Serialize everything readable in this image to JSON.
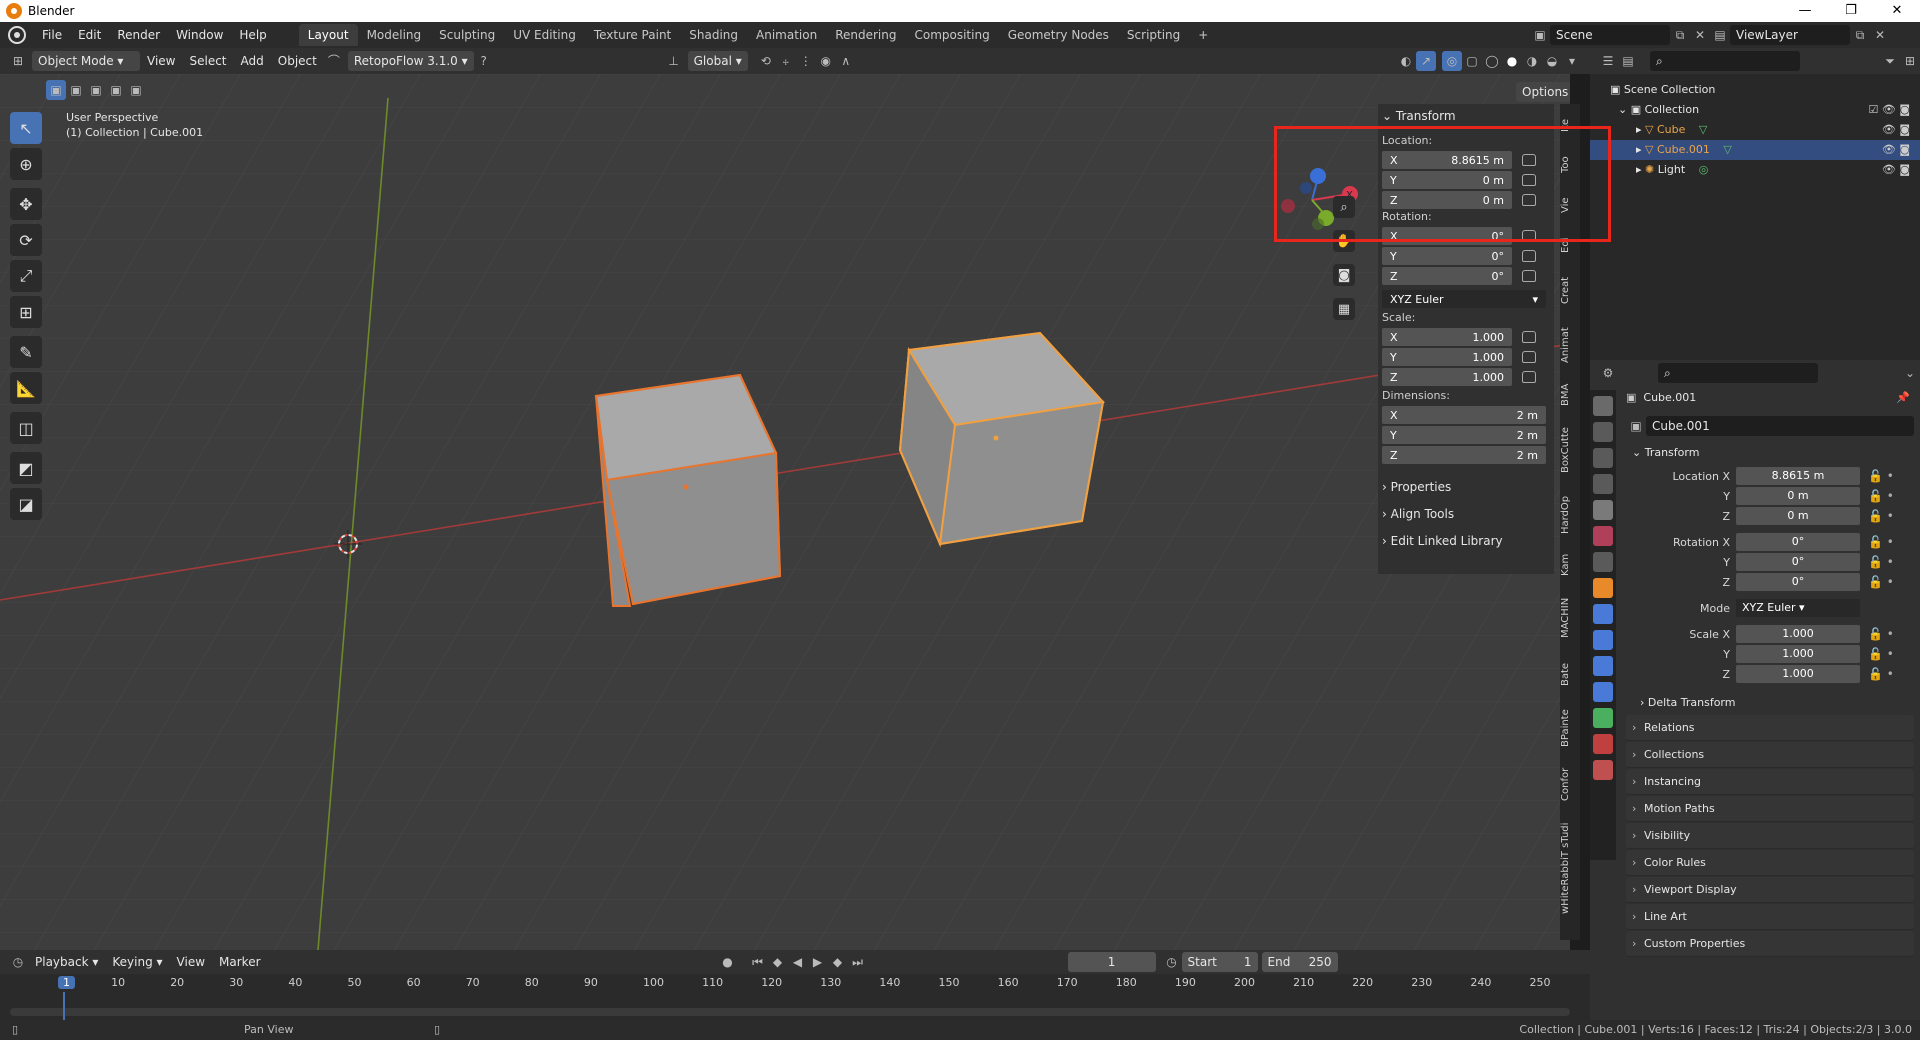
{
  "window": {
    "title": "Blender",
    "buttons": [
      "—",
      "❐",
      "✕"
    ]
  },
  "menu": [
    "File",
    "Edit",
    "Render",
    "Window",
    "Help"
  ],
  "workspaces": [
    "Layout",
    "Modeling",
    "Sculpting",
    "UV Editing",
    "Texture Paint",
    "Shading",
    "Animation",
    "Rendering",
    "Compositing",
    "Geometry Nodes",
    "Scripting"
  ],
  "active_workspace": "Layout",
  "scene": {
    "label": "Scene",
    "view_layer": "ViewLayer"
  },
  "viewport_header": {
    "mode": "Object Mode",
    "menus": [
      "View",
      "Select",
      "Add",
      "Object"
    ],
    "addon": "RetopoFlow 3.1.0",
    "orientation": "Global",
    "options": "Options"
  },
  "viewport_overlay": {
    "perspective": "User Perspective",
    "context": "(1) Collection | Cube.001"
  },
  "npanel": {
    "title": "Transform",
    "location_label": "Location:",
    "location": [
      {
        "axis": "X",
        "value": "8.8615 m"
      },
      {
        "axis": "Y",
        "value": "0 m"
      },
      {
        "axis": "Z",
        "value": "0 m"
      }
    ],
    "rotation_label": "Rotation:",
    "rotation": [
      {
        "axis": "X",
        "value": "0°"
      },
      {
        "axis": "Y",
        "value": "0°"
      },
      {
        "axis": "Z",
        "value": "0°"
      }
    ],
    "rotation_mode": "XYZ Euler",
    "scale_label": "Scale:",
    "scale": [
      {
        "axis": "X",
        "value": "1.000"
      },
      {
        "axis": "Y",
        "value": "1.000"
      },
      {
        "axis": "Z",
        "value": "1.000"
      }
    ],
    "dimensions_label": "Dimensions:",
    "dimensions": [
      {
        "axis": "X",
        "value": "2 m"
      },
      {
        "axis": "Y",
        "value": "2 m"
      },
      {
        "axis": "Z",
        "value": "2 m"
      }
    ],
    "sections": [
      "Properties",
      "Align Tools",
      "Edit Linked Library"
    ]
  },
  "vertical_tabs": [
    "Ite",
    "Too",
    "Vie",
    "Edi",
    "Creat",
    "Animat",
    "BMA",
    "BoxCutte",
    "HardOp",
    "Kam",
    "MACHIN",
    "Bate",
    "BPainte",
    "Confor",
    "wHiteRabbiT sTudi"
  ],
  "outliner": {
    "root": "Scene Collection",
    "collection": "Collection",
    "items": [
      {
        "name": "Cube",
        "selected": false,
        "color": "#e8a44a"
      },
      {
        "name": "Cube.001",
        "selected": true,
        "color": "#e8a44a"
      },
      {
        "name": "Light",
        "selected": false,
        "color": "#e6e6e6"
      }
    ]
  },
  "properties": {
    "object_name": "Cube.001",
    "datablock": "Cube.001",
    "transform_title": "Transform",
    "location": [
      {
        "label": "Location X",
        "value": "8.8615 m"
      },
      {
        "label": "Y",
        "value": "0 m"
      },
      {
        "label": "Z",
        "value": "0 m"
      }
    ],
    "rotation": [
      {
        "label": "Rotation X",
        "value": "0°"
      },
      {
        "label": "Y",
        "value": "0°"
      },
      {
        "label": "Z",
        "value": "0°"
      }
    ],
    "mode_label": "Mode",
    "mode": "XYZ Euler",
    "scale": [
      {
        "label": "Scale X",
        "value": "1.000"
      },
      {
        "label": "Y",
        "value": "1.000"
      },
      {
        "label": "Z",
        "value": "1.000"
      }
    ],
    "delta": "Delta Transform",
    "sections": [
      "Relations",
      "Collections",
      "Instancing",
      "Motion Paths",
      "Visibility",
      "Color Rules",
      "Viewport Display",
      "Line Art",
      "Custom Properties"
    ]
  },
  "timeline": {
    "menus": [
      "Playback",
      "Keying",
      "View",
      "Marker"
    ],
    "current_frame": "1",
    "start_label": "Start",
    "start": "1",
    "end_label": "End",
    "end": "250",
    "ticks": [
      "1",
      "10",
      "20",
      "30",
      "40",
      "50",
      "60",
      "70",
      "80",
      "90",
      "100",
      "110",
      "120",
      "130",
      "140",
      "150",
      "160",
      "170",
      "180",
      "190",
      "200",
      "210",
      "220",
      "230",
      "240",
      "250"
    ]
  },
  "status": {
    "left": "Pan View",
    "right": "Collection | Cube.001 | Verts:16 | Faces:12 | Tris:24 | Objects:2/3 | 3.0.0"
  },
  "colors": {
    "accent": "#4772b3",
    "selection_orange": "#e8742e",
    "highlight_box": "#e8261b"
  }
}
